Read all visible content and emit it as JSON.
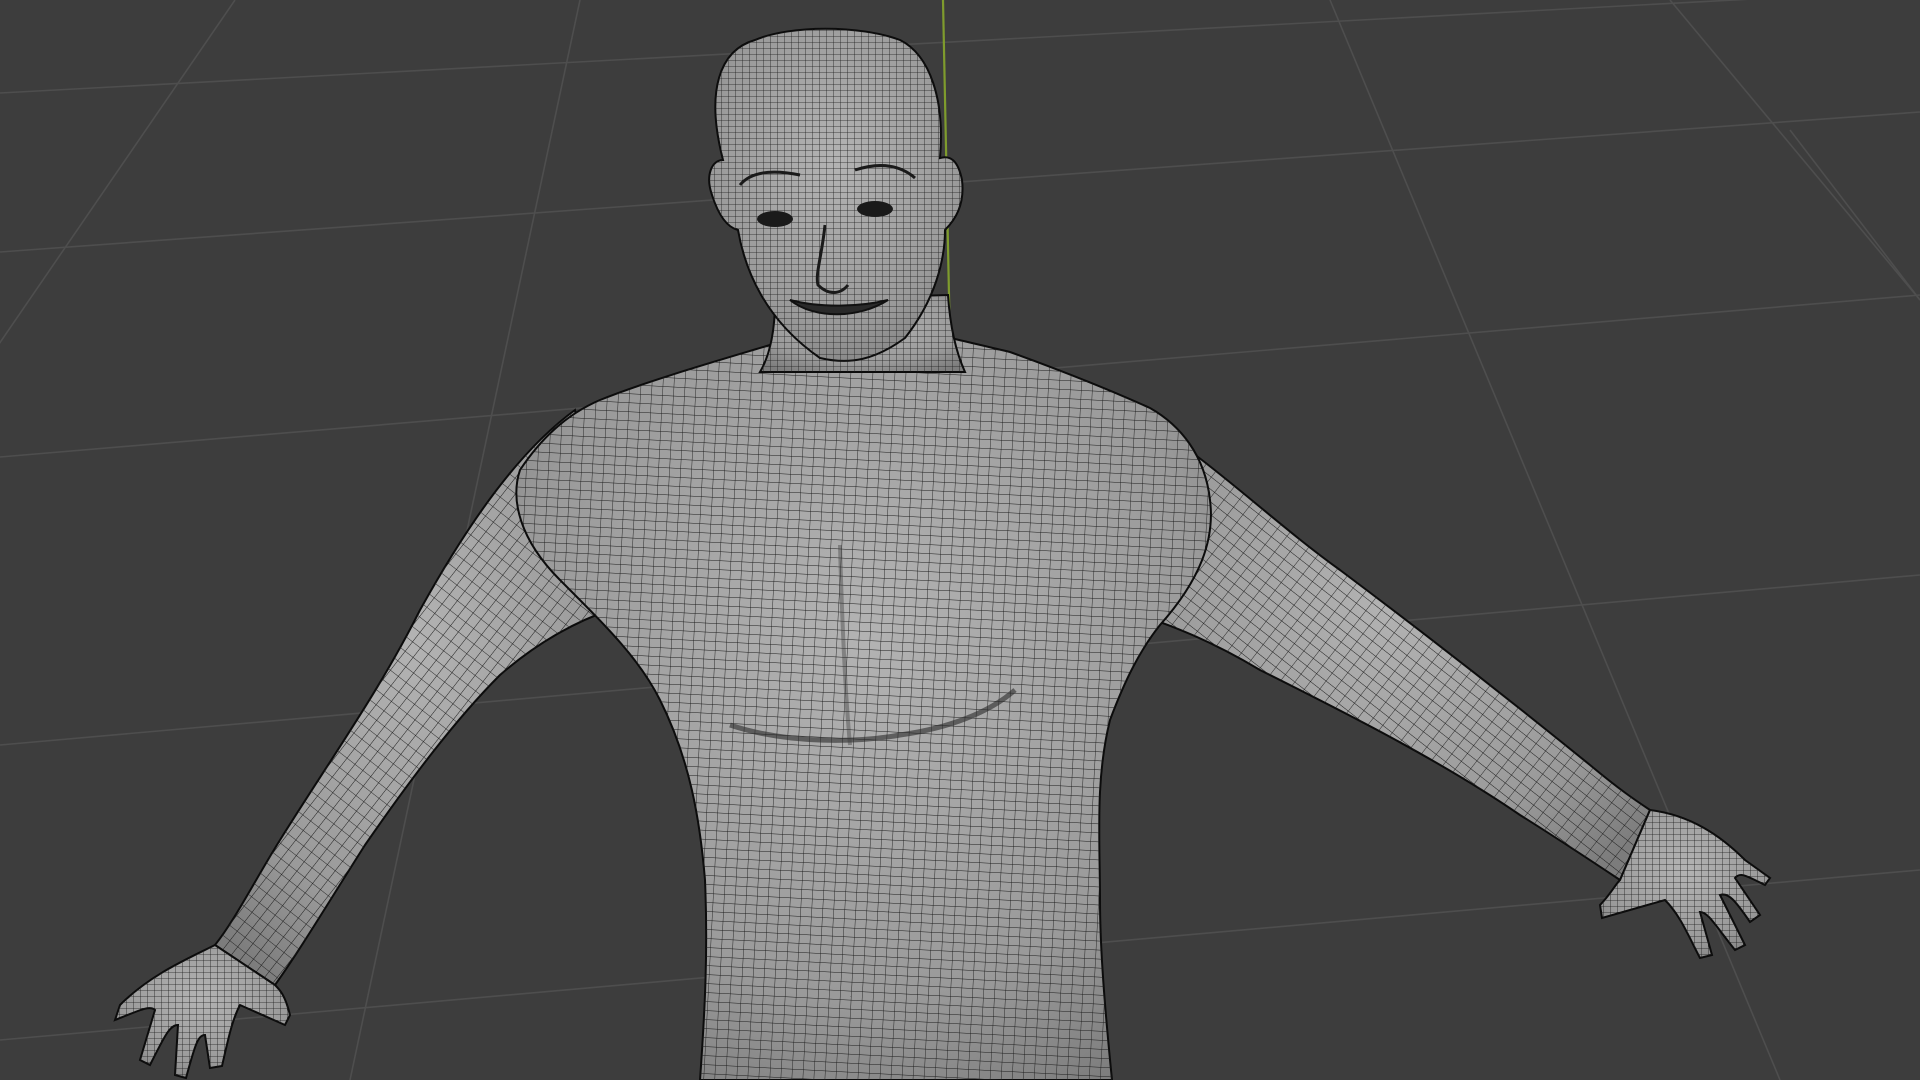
{
  "viewport": {
    "mode": "3d-viewport",
    "shading": "solid",
    "wireframe_overlay": true,
    "object": "humanoid-mesh-a-pose"
  },
  "colors": {
    "background": "#3d3d3d",
    "grid_line": "#4e4e4e",
    "y_axis": "#7f9c2d",
    "mesh_fill": "#9c9c9c",
    "mesh_wire": "#1a1a1a",
    "mesh_outline": "#0c0c0c"
  }
}
